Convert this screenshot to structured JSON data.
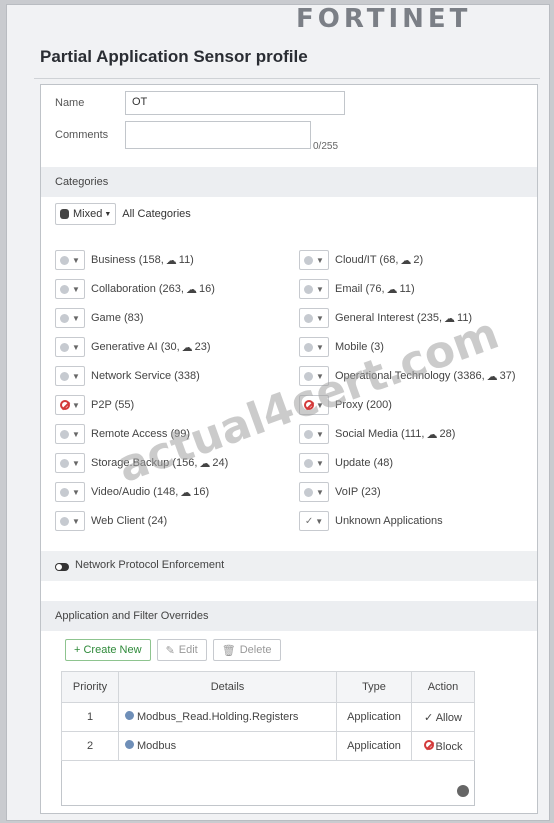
{
  "logo_text": "FORTINET",
  "panel_title": "Partial Application Sensor profile",
  "form": {
    "name_label": "Name",
    "name_value": "OT",
    "comments_label": "Comments",
    "comments_count": "0/255"
  },
  "categories_section": {
    "title": "Categories",
    "mixed_label": "Mixed",
    "all_categories_label": "All Categories"
  },
  "categories_left": [
    {
      "icon": "monitor",
      "label": "Business (158,",
      "cloud": "11)"
    },
    {
      "icon": "monitor",
      "label": "Collaboration (263,",
      "cloud": "16)"
    },
    {
      "icon": "monitor",
      "label": "Game (83)",
      "cloud": ""
    },
    {
      "icon": "monitor",
      "label": "Generative AI (30,",
      "cloud": "23)"
    },
    {
      "icon": "monitor",
      "label": "Network Service (338)",
      "cloud": ""
    },
    {
      "icon": "block",
      "label": "P2P (55)",
      "cloud": ""
    },
    {
      "icon": "monitor",
      "label": "Remote Access (99)",
      "cloud": ""
    },
    {
      "icon": "monitor",
      "label": "Storage.Backup (156,",
      "cloud": "24)"
    },
    {
      "icon": "monitor",
      "label": "Video/Audio (148,",
      "cloud": "16)"
    },
    {
      "icon": "monitor",
      "label": "Web Client (24)",
      "cloud": ""
    }
  ],
  "categories_right": [
    {
      "icon": "monitor",
      "label": "Cloud/IT (68,",
      "cloud": "2)"
    },
    {
      "icon": "monitor",
      "label": "Email (76,",
      "cloud": "11)"
    },
    {
      "icon": "monitor",
      "label": "General Interest (235,",
      "cloud": "11)"
    },
    {
      "icon": "monitor",
      "label": "Mobile (3)",
      "cloud": ""
    },
    {
      "icon": "monitor",
      "label": "Operational Technology (3386,",
      "cloud": "37)"
    },
    {
      "icon": "block",
      "label": "Proxy (200)",
      "cloud": ""
    },
    {
      "icon": "monitor",
      "label": "Social Media (111,",
      "cloud": "28)"
    },
    {
      "icon": "monitor",
      "label": "Update (48)",
      "cloud": ""
    },
    {
      "icon": "monitor",
      "label": "VoIP (23)",
      "cloud": ""
    },
    {
      "icon": "check",
      "label": "Unknown Applications",
      "cloud": ""
    }
  ],
  "network_protocol_label": "Network Protocol Enforcement",
  "overrides": {
    "title": "Application and Filter Overrides",
    "create_new": "+ Create New",
    "edit": "Edit",
    "delete": "Delete",
    "headers": [
      "Priority",
      "Details",
      "Type",
      "Action"
    ],
    "rows": [
      {
        "priority": "1",
        "details": "Modbus_Read.Holding.Registers",
        "type": "Application",
        "action": "Allow"
      },
      {
        "priority": "2",
        "details": "Modbus",
        "type": "Application",
        "action": "Block"
      }
    ]
  },
  "watermark": "actual4cert.com",
  "colors": {
    "block_red": "#d33a3a",
    "create_green": "#2f8a3a"
  }
}
